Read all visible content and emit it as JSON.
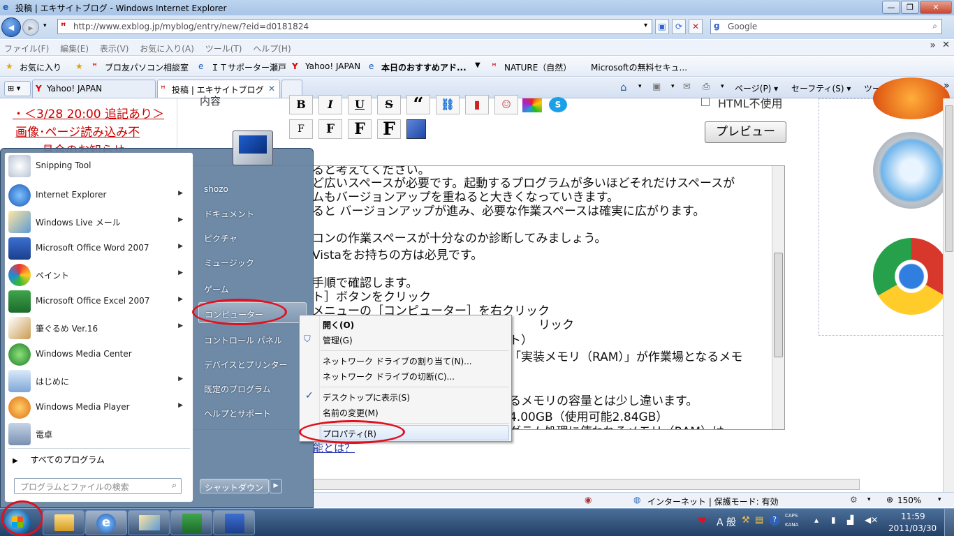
{
  "window": {
    "title": "投稿 | エキサイトブログ - Windows Internet Explorer",
    "minimize": "—",
    "restore": "❐",
    "close": "✕"
  },
  "nav": {
    "back": "◀",
    "forward": "▶",
    "address": "http://www.exblog.jp/myblog/entry/new/?eid=d0181824",
    "search_placeholder": "Google"
  },
  "menubar": [
    "ファイル(F)",
    "編集(E)",
    "表示(V)",
    "お気に入り(A)",
    "ツール(T)",
    "ヘルプ(H)"
  ],
  "favorites": {
    "label": "お気に入り",
    "items": [
      "ブロ友パソコン相談室",
      "ＩＴサポーター瀬戸",
      "Yahoo! JAPAN",
      "本日のおすすめアド...",
      "NATURE（自然）",
      "Microsoftの無料セキュ..."
    ]
  },
  "tabs": [
    {
      "label": "Yahoo! JAPAN"
    },
    {
      "label": "投稿 | エキサイトブログ",
      "close": "✕"
    }
  ],
  "command_bar": [
    "ページ(P) ▾",
    "セーフティ(S) ▾",
    "ツール(O) ▾"
  ],
  "page": {
    "notice_lines": [
      "・＜3/28 20:00 追記あり＞",
      "画像･ページ読み込み不",
      "具合のお知らせ"
    ],
    "label_partial": "内容",
    "html_checkbox_label": "HTML不使用",
    "preview_button": "プレビュー",
    "bottom_link": "能とは？",
    "format_buttons": [
      "B",
      "I",
      "U",
      "S",
      "“",
      "F",
      "F",
      "F",
      "F"
    ],
    "editor_lines": [
      "ると考えてください。",
      "ど広いスペースが必要です。起動するプログラムが多いほどそれだけスペースが",
      "ムもバージョンアップを重ねると大きくなっていきます。",
      "ると バージョンアップが進み、必要な作業スペースは確実に広がります。",
      "",
      "コンの作業スペースが十分なのか診断してみましょう。",
      "Vistaをお持ちの方は必見です。",
      "",
      "手順で確認します。",
      "ト］ボタンをクリック",
      "メニューの［コンピューター］を右クリック",
      "リック",
      "ト）",
      "「実装メモリ（RAM）」が作業場となるメモ",
      "",
      "るメモリの容量とは少し違います。",
      "4.00GB（使用可能2.84GB）",
      "グラム処理に使われるメモリ（RAM）は"
    ]
  },
  "status": {
    "zone": "インターネット | 保護モード: 有効",
    "zoom": "150%"
  },
  "start_menu": {
    "programs": [
      {
        "label": "Snipping Tool",
        "arrow": ""
      },
      {
        "label": "Internet Explorer",
        "arrow": "▶"
      },
      {
        "label": "Windows Live メール",
        "arrow": "▶"
      },
      {
        "label": "Microsoft Office Word 2007",
        "arrow": "▶"
      },
      {
        "label": "ペイント",
        "arrow": "▶"
      },
      {
        "label": "Microsoft Office Excel 2007",
        "arrow": "▶"
      },
      {
        "label": "筆ぐるめ Ver.16",
        "arrow": "▶"
      },
      {
        "label": "Windows Media Center",
        "arrow": ""
      },
      {
        "label": "はじめに",
        "arrow": "▶"
      },
      {
        "label": "Windows Media Player",
        "arrow": "▶"
      },
      {
        "label": "電卓",
        "arrow": ""
      }
    ],
    "all_programs": "すべてのプログラム",
    "search_placeholder": "プログラムとファイルの検索",
    "right_items": [
      "shozo",
      "ドキュメント",
      "ピクチャ",
      "ミュージック",
      "ゲーム",
      "コンピューター",
      "コントロール パネル",
      "デバイスとプリンター",
      "既定のプログラム",
      "ヘルプとサポート"
    ],
    "shutdown": "シャットダウン"
  },
  "context_menu": {
    "items": [
      "開く(O)",
      "管理(G)",
      "ネットワーク ドライブの割り当て(N)...",
      "ネットワーク ドライブの切断(C)...",
      "デスクトップに表示(S)",
      "名前の変更(M)",
      "プロパティ(R)"
    ],
    "check": "✓"
  },
  "tray": {
    "ime": "A 般",
    "caps": "CAPS",
    "kana": "KANA",
    "time": "11:59",
    "date": "2011/03/30"
  },
  "colors": {
    "accent": "#1b58b8",
    "highlight_ring": "#e0101e",
    "link_red": "#cc0000"
  }
}
